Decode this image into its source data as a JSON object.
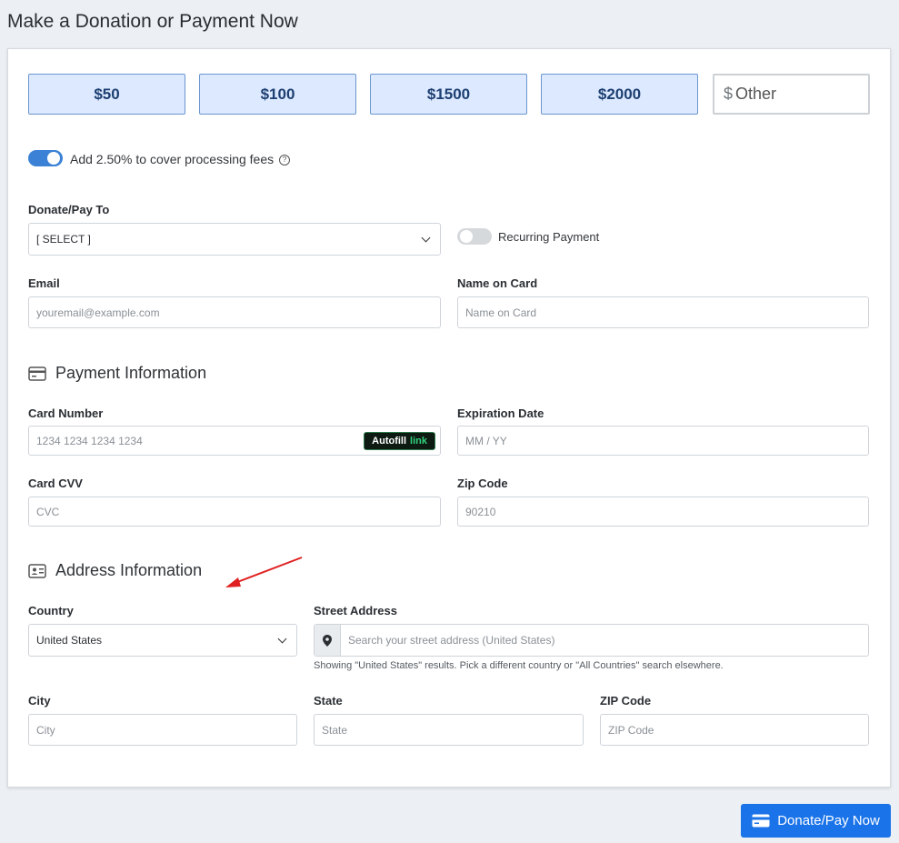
{
  "header": {
    "title": "Make a Donation or Payment Now"
  },
  "amounts": {
    "a50": "$50",
    "a100": "$100",
    "a1500": "$1500",
    "a2000": "$2000",
    "other_symbol": "$",
    "other_label": "Other"
  },
  "fees": {
    "label": "Add 2.50% to cover processing fees",
    "help_icon": "?"
  },
  "donate_to": {
    "label": "Donate/Pay To",
    "value": "[ SELECT ]"
  },
  "recurring": {
    "label": "Recurring Payment"
  },
  "email": {
    "label": "Email",
    "placeholder": "youremail@example.com"
  },
  "name_on_card": {
    "label": "Name on Card",
    "placeholder": "Name on Card"
  },
  "payment_section": {
    "title": "Payment Information"
  },
  "card_number": {
    "label": "Card Number",
    "placeholder": "1234 1234 1234 1234",
    "autofill": "Autofill",
    "autofill_link": "link"
  },
  "expiration": {
    "label": "Expiration Date",
    "placeholder": "MM / YY"
  },
  "cvv": {
    "label": "Card CVV",
    "placeholder": "CVC"
  },
  "zip": {
    "label": "Zip Code",
    "placeholder": "90210"
  },
  "address_section": {
    "title": "Address Information"
  },
  "country": {
    "label": "Country",
    "value": "United States"
  },
  "street": {
    "label": "Street Address",
    "placeholder": "Search your street address (United States)",
    "hint": "Showing \"United States\" results. Pick a different country or \"All Countries\" search elsewhere."
  },
  "city": {
    "label": "City",
    "placeholder": "City"
  },
  "state": {
    "label": "State",
    "placeholder": "State"
  },
  "zip_code": {
    "label": "ZIP Code",
    "placeholder": "ZIP Code"
  },
  "submit": {
    "label": "Donate/Pay Now"
  },
  "colors": {
    "accent": "#1a73e8",
    "toggle_on": "#3b82d6",
    "amount_bg": "#dce9fe",
    "arrow": "#e02020"
  }
}
